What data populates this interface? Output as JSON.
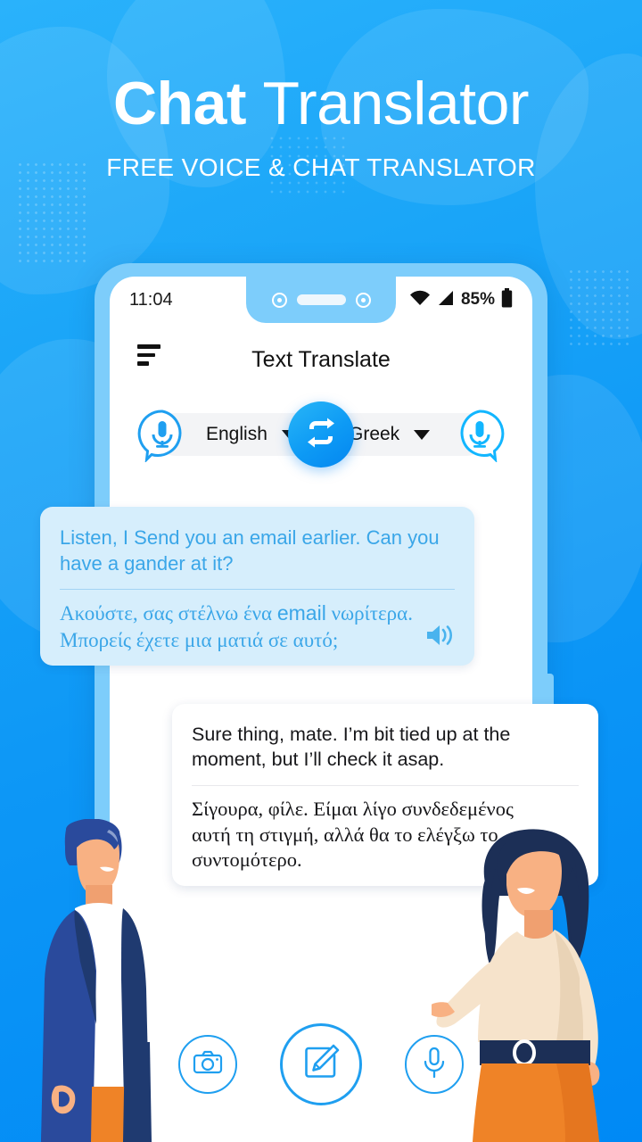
{
  "hero": {
    "title_bold": "Chat",
    "title_light": "Translator",
    "subtitle": "FREE VOICE & CHAT TRANSLATOR"
  },
  "phone": {
    "status": {
      "time": "11:04",
      "battery_percent": "85%",
      "wifi_icon": "wifi-icon",
      "signal_icon": "signal-icon",
      "battery_icon": "battery-icon"
    },
    "appbar": {
      "menu_icon": "menu-icon",
      "title": "Text Translate"
    },
    "language_bar": {
      "source_language": "English",
      "target_language": "Greek",
      "swap_icon": "swap-arrows-icon",
      "source_mic_icon": "microphone-bubble-icon",
      "target_mic_icon": "microphone-bubble-icon",
      "source_caret": "chevron-down-icon",
      "target_caret": "chevron-down-icon"
    },
    "messages": [
      {
        "side": "left",
        "source_text": "Listen, I Send you an email earlier. Can you have a gander at it?",
        "translated_prefix": "Ακούστε, σας στέλνω ένα ",
        "translated_latin": "email",
        "translated_suffix": " νωρίτερα. Μπορείς έχετε μια ματιά σε αυτό;",
        "speaker_icon": "speaker-icon"
      },
      {
        "side": "right",
        "source_text": "Sure thing, mate. I’m bit tied up at the moment, but I’ll check it asap.",
        "translated_text": "Σίγουρα, φίλε. Είμαι λίγο συνδεδεμένος αυτή τη στιγμή, αλλά θα το ελέγξω το συντομότερο.",
        "speaker_icon": "speaker-icon"
      }
    ],
    "actions": [
      {
        "icon": "camera-icon",
        "label": "Camera translate"
      },
      {
        "icon": "compose-icon",
        "label": "Text translate"
      },
      {
        "icon": "microphone-icon",
        "label": "Voice translate"
      }
    ]
  },
  "colors": {
    "background_blue": "#0d97f6",
    "accent_blue": "#1f9ff0",
    "bubble_left_bg": "#d6eefc",
    "bubble_left_text": "#3aa6e8",
    "bubble_right_bg": "#ffffff",
    "bubble_right_text": "#17171a",
    "phone_frame": "#7dcdfb",
    "orange": "#ef8327",
    "navy": "#1f3a70"
  },
  "illustrations": {
    "left_person": "man-illustration",
    "right_person": "woman-illustration"
  }
}
